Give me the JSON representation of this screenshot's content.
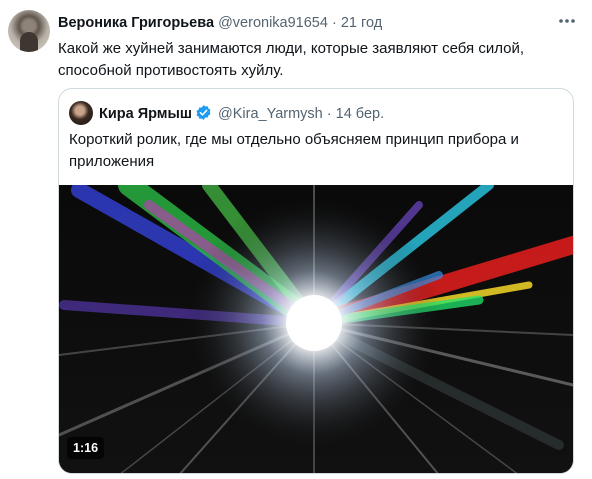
{
  "tweet": {
    "author_name": "Вероника Григорьева",
    "author_handle": "@veronika91654",
    "separator": "·",
    "time": "21 год",
    "text": "Какой же хуйней занимаются люди, которые заявляют себя силой, способной противостоять хуйлу.",
    "more_icon": "more-horizontal-icon"
  },
  "quoted_tweet": {
    "author_name": "Кира Ярмыш",
    "verified_icon": "verified-badge-icon",
    "author_handle": "@Kira_Yarmysh",
    "separator": "·",
    "time": "14 бер.",
    "text": "Короткий ролик, где мы отдельно объясняем принцип прибора и приложения",
    "media": {
      "duration": "1:16"
    }
  },
  "colors": {
    "text_primary": "#0f1419",
    "text_secondary": "#536471",
    "border": "#cfd9de",
    "verified": "#1d9bf0"
  }
}
